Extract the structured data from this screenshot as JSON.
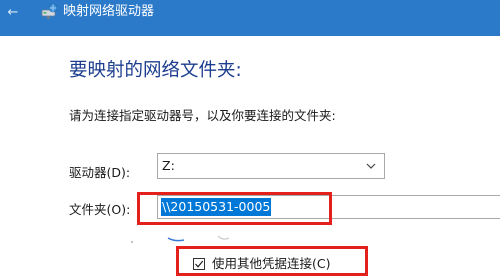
{
  "window": {
    "title": "映射网络驱动器",
    "back_icon": "back-arrow-icon",
    "title_icon": "network-drive-icon",
    "title_bar_color": "#2b79c9"
  },
  "main": {
    "heading": "要映射的网络文件夹:",
    "instruction": "请为连接指定驱动器号，以及你要连接的文件夹:",
    "drive": {
      "label": "驱动器(D):",
      "value": "Z:"
    },
    "folder": {
      "label": "文件夹(O):",
      "value": "\\\\20150531-0005",
      "selected": true
    },
    "credentials": {
      "label": "使用其他凭据连接(C)",
      "checked": true
    }
  },
  "colors": {
    "heading": "#1d3e8f",
    "selection": "#0078d7",
    "annotation_red": "#e3201b"
  }
}
